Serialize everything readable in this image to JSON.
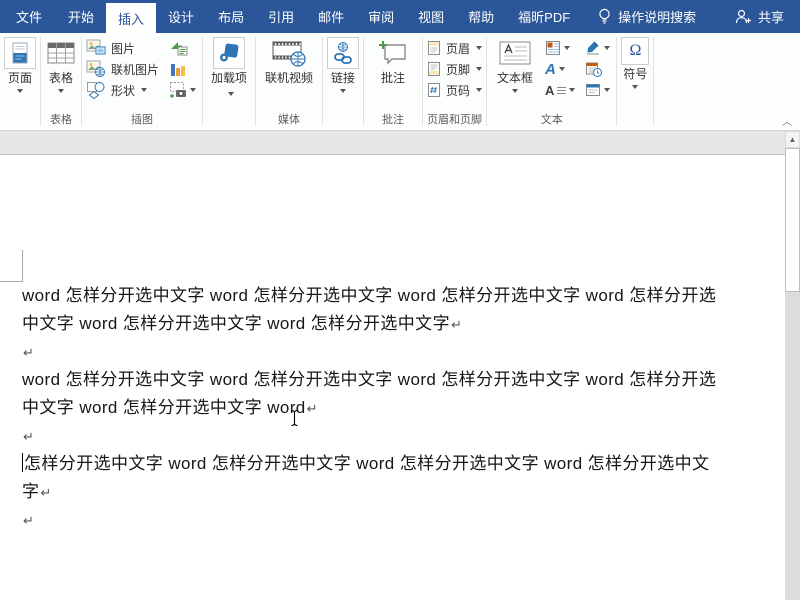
{
  "app": {
    "accent_color": "#2b579a"
  },
  "tabbar": {
    "tabs": [
      {
        "label": "文件"
      },
      {
        "label": "开始"
      },
      {
        "label": "插入"
      },
      {
        "label": "设计"
      },
      {
        "label": "布局"
      },
      {
        "label": "引用"
      },
      {
        "label": "邮件"
      },
      {
        "label": "审阅"
      },
      {
        "label": "视图"
      },
      {
        "label": "帮助"
      },
      {
        "label": "福昕PDF"
      }
    ],
    "active_tab": "插入",
    "tell_me": "操作说明搜索",
    "share": "共享"
  },
  "ribbon": {
    "pages": {
      "label": "页面"
    },
    "tables": {
      "label": "表格",
      "group": "表格"
    },
    "illustrations": {
      "group": "插图",
      "pictures": "图片",
      "online_pictures": "联机图片",
      "shapes": "形状"
    },
    "addins": {
      "label": "加载项"
    },
    "media": {
      "online_video": "联机视频",
      "group": "媒体"
    },
    "links": {
      "label": "链接"
    },
    "comments": {
      "label": "批注",
      "group": "批注"
    },
    "header_footer": {
      "group": "页眉和页脚",
      "header": "页眉",
      "footer": "页脚",
      "page_number": "页码"
    },
    "text": {
      "group": "文本",
      "textbox": "文本框"
    },
    "symbols": {
      "label": "符号"
    }
  },
  "icons": {
    "dropdown": "css-triangle",
    "omega": "Ω",
    "wordart_glyph": "A",
    "dropcap_glyph": "A",
    "scroll_up": "▲",
    "collapse_ribbon": "︿"
  },
  "document": {
    "lines": [
      {
        "text": "word 怎样分开选中文字 word 怎样分开选中文字 word 怎样分开选中文字 word 怎样分开选",
        "mark": ""
      },
      {
        "text": "中文字 word 怎样分开选中文字 word 怎样分开选中文字",
        "mark": "↵"
      },
      {
        "text": "",
        "mark": "↵"
      },
      {
        "text": "word 怎样分开选中文字 word 怎样分开选中文字 word 怎样分开选中文字 word 怎样分开选",
        "mark": ""
      },
      {
        "text": "中文字 word 怎样分开选中文字 word",
        "mark": "↵"
      },
      {
        "text": "",
        "mark": "↵"
      },
      {
        "text": "怎样分开选中文字 word 怎样分开选中文字 word 怎样分开选中文字 word 怎样分开选中文",
        "mark": ""
      },
      {
        "text": "字",
        "mark": "↵"
      },
      {
        "text": "",
        "mark": "↵"
      }
    ]
  }
}
